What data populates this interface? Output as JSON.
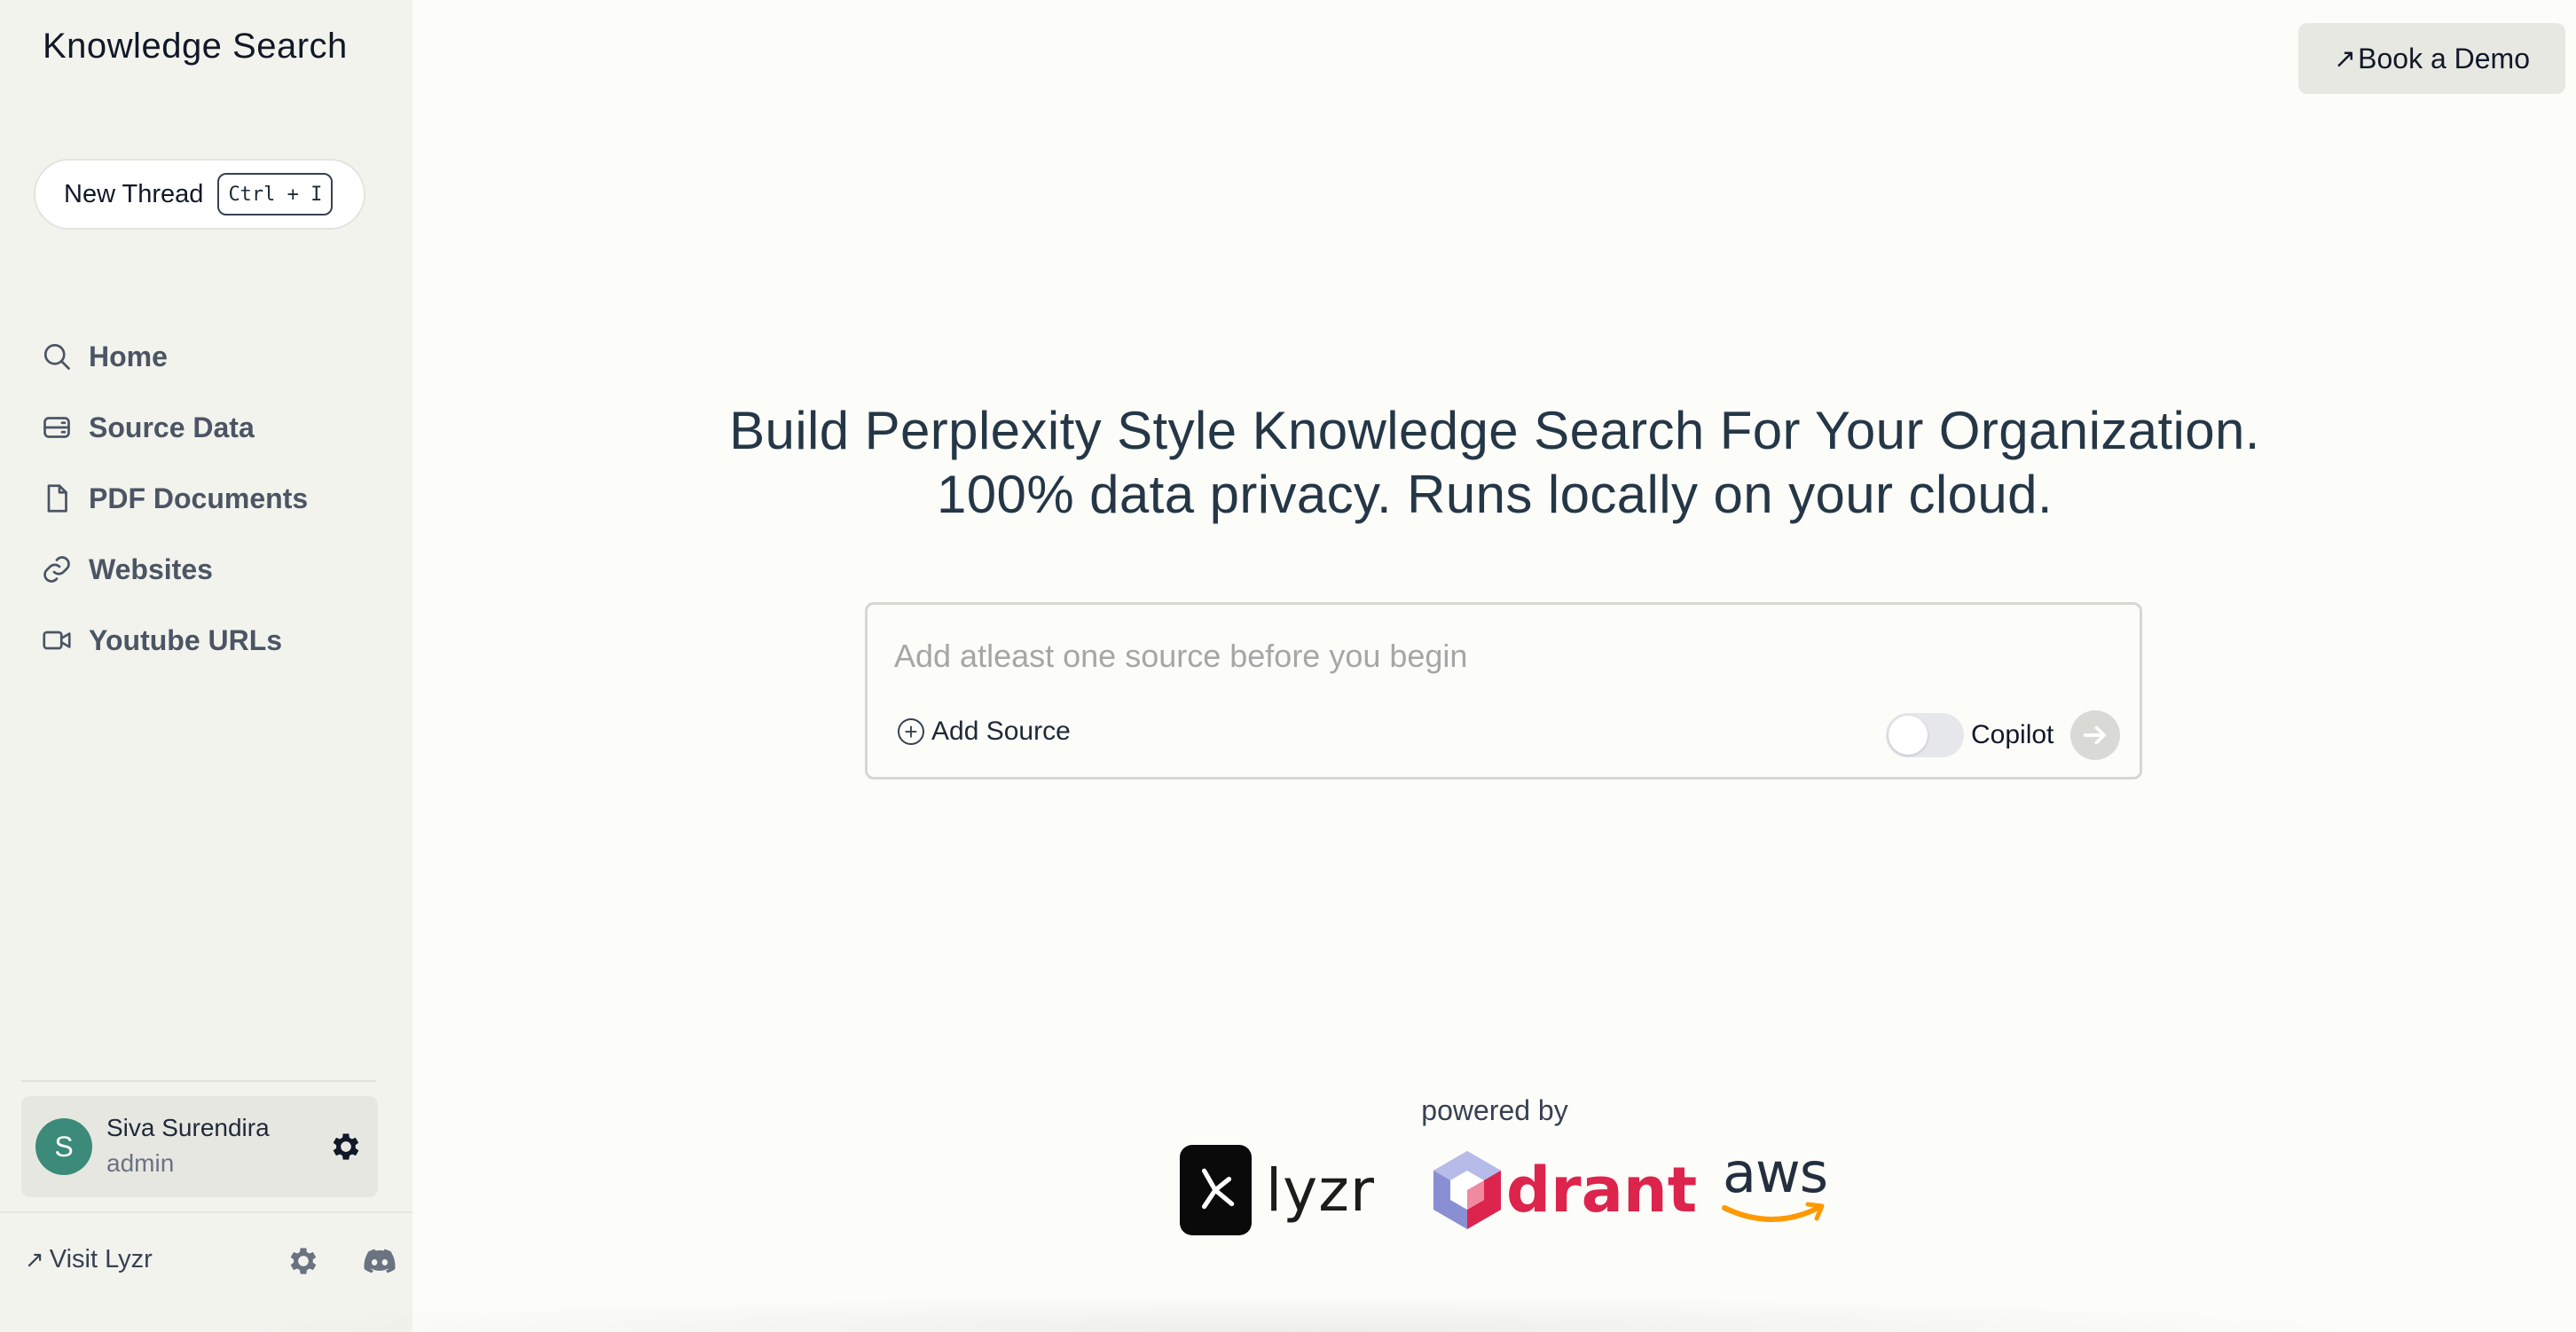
{
  "app": {
    "title": "Knowledge Search"
  },
  "sidebar": {
    "new_thread": {
      "label": "New Thread",
      "shortcut": "Ctrl + I"
    },
    "items": [
      {
        "label": "Home",
        "icon": "search-icon"
      },
      {
        "label": "Source Data",
        "icon": "database-icon"
      },
      {
        "label": "PDF Documents",
        "icon": "document-icon"
      },
      {
        "label": "Websites",
        "icon": "link-icon"
      },
      {
        "label": "Youtube URLs",
        "icon": "video-icon"
      }
    ],
    "user": {
      "initial": "S",
      "name": "Siva Surendira",
      "role": "admin",
      "avatar_color": "#3c8a79"
    },
    "footer": {
      "visit_label": "Visit Lyzr"
    }
  },
  "header": {
    "demo_button": "Book a Demo"
  },
  "hero": {
    "line1": "Build Perplexity Style Knowledge Search For Your Organization.",
    "line2": "100% data privacy. Runs locally on your cloud."
  },
  "search": {
    "placeholder": "Add atleast one source before you begin",
    "value": "",
    "add_source_label": "Add Source",
    "copilot_label": "Copilot",
    "copilot_enabled": false
  },
  "powered": {
    "label": "powered by",
    "logos": [
      {
        "name": "lyzr",
        "text": "lyzr"
      },
      {
        "name": "qdrant",
        "text": "drant",
        "color": "#dc244c"
      },
      {
        "name": "aws",
        "text": "aws",
        "color": "#ff9900"
      }
    ]
  }
}
